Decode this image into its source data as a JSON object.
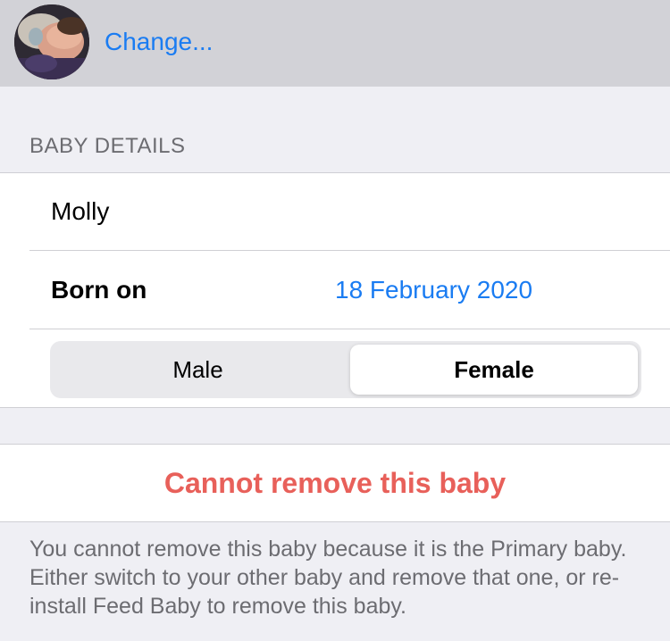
{
  "header": {
    "avatar_icon": "baby-photo-avatar",
    "change_label": "Change..."
  },
  "baby_details": {
    "section_label": "BABY DETAILS",
    "name_value": "Molly",
    "born_on_label": "Born on",
    "born_on_value": "18 February 2020",
    "gender": {
      "options": [
        "Male",
        "Female"
      ],
      "selected": "Female"
    }
  },
  "remove": {
    "label": "Cannot remove this baby",
    "note": "You cannot remove this baby because it is the Primary baby. Either switch to your other baby and remove that one, or re-install Feed Baby to remove this baby."
  },
  "colors": {
    "accent": "#1a7cf2",
    "destructive": "#e8605a",
    "background": "#efeff4",
    "header_bg": "#d2d2d7"
  }
}
